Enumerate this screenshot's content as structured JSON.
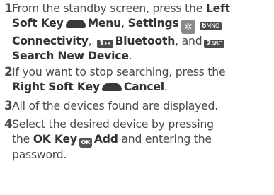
{
  "steps": [
    {
      "num": "1",
      "l1_pre": "From the standby screen, press the ",
      "l1_bold": "Left",
      "l2_bold1": "Soft Key",
      "l2_bold2": "Menu",
      "l2_sep": ", ",
      "l2_bold3": "Settings",
      "l3_bold1": "Connectivity",
      "l3_sep": ", ",
      "l3_bold2": "Bluetooth",
      "l3_and": ", and",
      "l4_bold": "Search New Device",
      "l4_end": "."
    },
    {
      "num": "2",
      "l1_text": "If you want to stop searching, press the",
      "l2_bold1": "Right Soft Key",
      "l2_bold2": "Cancel",
      "l2_end": "."
    },
    {
      "num": "3",
      "l1_text": "All of the devices found are displayed."
    },
    {
      "num": "4",
      "l1_text": "Select the desired device by pressing",
      "l2_pre": "the ",
      "l2_bold1": "OK Key",
      "l2_bold2": "Add",
      "l2_post": " and entering the",
      "l3_text": "password."
    }
  ],
  "keys": {
    "ok": "OK",
    "six_digit": "6",
    "six_letters": "MNO",
    "one_digit": "1",
    "one_letters": "∙∙",
    "two_digit": "2",
    "two_letters": "ABC"
  },
  "icons": {
    "left_soft_key": "left-soft-key-icon",
    "right_soft_key": "right-soft-key-icon",
    "settings": "settings-gear-icon"
  }
}
